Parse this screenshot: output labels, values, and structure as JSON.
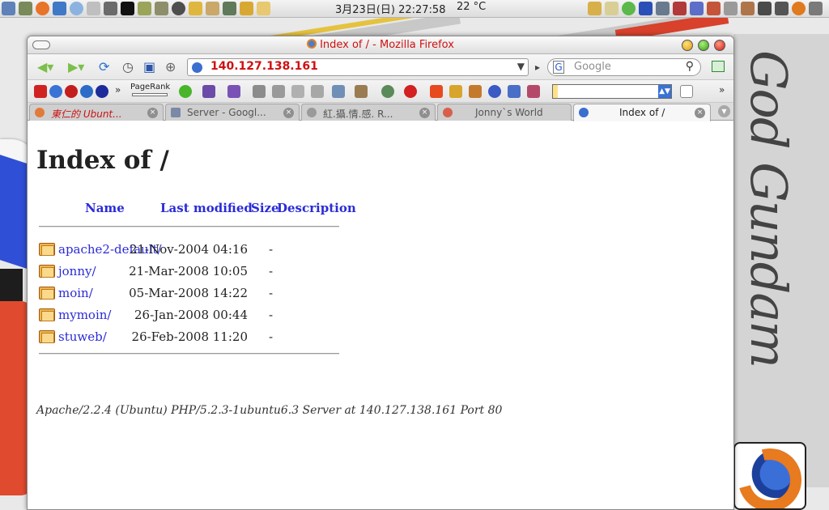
{
  "topbar": {
    "clock": "3月23日(日) 22:27:58",
    "weather": "22 °C"
  },
  "window": {
    "title": "Index of / - Mozilla Firefox"
  },
  "navbar": {
    "url": "140.127.138.161",
    "search_placeholder": "Google"
  },
  "toolbar": {
    "pagerank_label": "PageRank",
    "overflow": "»"
  },
  "tabs": [
    {
      "label": "東仁的 Ubunt..."
    },
    {
      "label": "Server - Googl..."
    },
    {
      "label": "紅.攝.情.感. R..."
    },
    {
      "label": "Jonny`s World"
    },
    {
      "label": "Index of /"
    }
  ],
  "page": {
    "title": "Index of /",
    "columns": {
      "name": "Name",
      "last_modified": "Last modified",
      "size": "Size",
      "description": "Description"
    },
    "rows": [
      {
        "name": "apache2-default/",
        "date": "21-Nov-2004 04:16",
        "size": "-"
      },
      {
        "name": "jonny/",
        "date": "21-Mar-2008 10:05",
        "size": "-"
      },
      {
        "name": "moin/",
        "date": "05-Mar-2008 14:22",
        "size": "-"
      },
      {
        "name": "mymoin/",
        "date": "26-Jan-2008 00:44",
        "size": "-"
      },
      {
        "name": "stuweb/",
        "date": "26-Feb-2008 11:20",
        "size": "-"
      }
    ],
    "address": "Apache/2.2.4 (Ubuntu) PHP/5.2.3-1ubuntu6.3 Server at 140.127.138.161 Port 80"
  },
  "desktop": {
    "script_text": "God Gundam"
  }
}
